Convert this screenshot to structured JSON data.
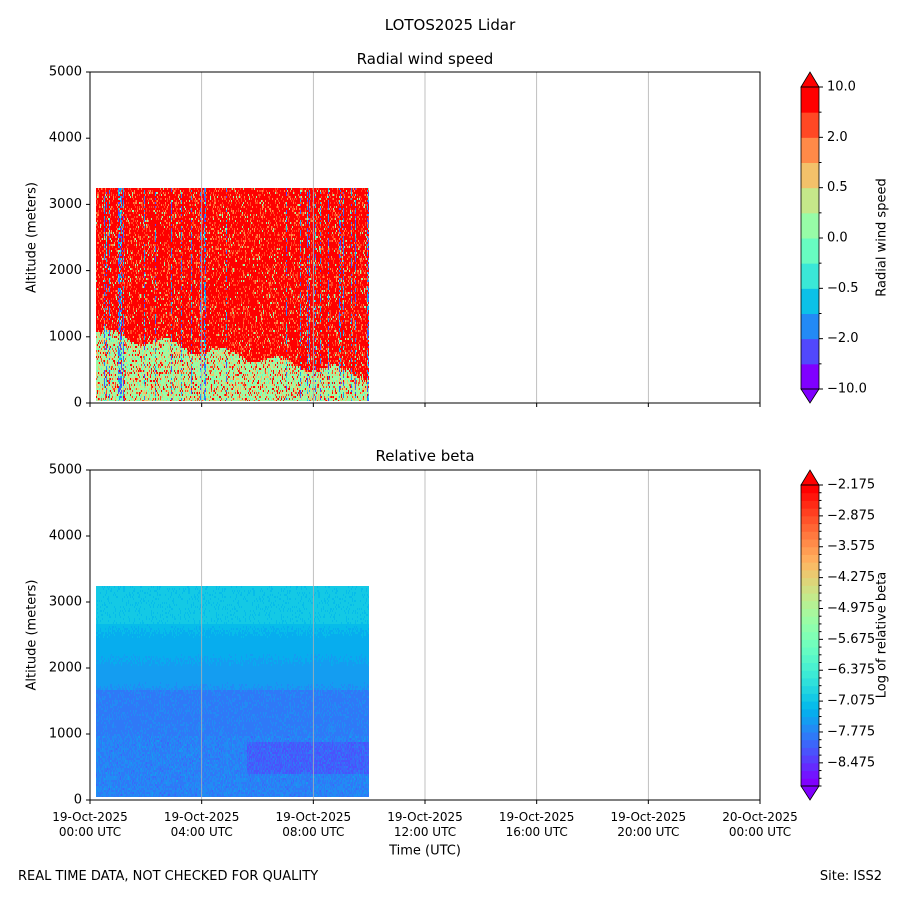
{
  "suptitle": "LOTOS2025 Lidar",
  "footer_left": "REAL TIME DATA, NOT CHECKED FOR QUALITY",
  "footer_right": "Site: ISS2",
  "chart_data": [
    {
      "type": "heatmap",
      "title": "Radial wind speed",
      "ylabel": "Altitude (meters)",
      "xlabel": "",
      "xlim": [
        "2025-10-19 00:00",
        "2025-10-20 00:00"
      ],
      "ylim": [
        0,
        5000
      ],
      "yticks": [
        "0",
        "1000",
        "2000",
        "3000",
        "4000",
        "5000"
      ],
      "xgrid": true,
      "ygrid": false,
      "data_extent": {
        "time": [
          "2025-10-19 00:13",
          "2025-10-19 10:00"
        ],
        "altitude": [
          25,
          3250
        ]
      },
      "colormap": "rainbow",
      "colorbar": {
        "label": "Radial wind speed",
        "levels": [
          -10,
          -5,
          -2,
          -1,
          -0.5,
          -0.2,
          0,
          0.2,
          0.5,
          1,
          2,
          5,
          10
        ],
        "ticklabels": [
          "10.0",
          "2.0",
          "0.5",
          "0.0",
          "−0.5",
          "−2.0",
          "−10.0"
        ],
        "extend": "both"
      },
      "description_values": {
        "above_boundary_layer": "mostly > 5",
        "below_boundary_layer": "mostly 0 to 1",
        "boundary_layer_height_m": [
          300,
          1100
        ]
      }
    },
    {
      "type": "heatmap",
      "title": "Relative beta",
      "ylabel": "Altitude (meters)",
      "xlabel": "Time (UTC)",
      "xlim": [
        "2025-10-19 00:00",
        "2025-10-20 00:00"
      ],
      "ylim": [
        0,
        5000
      ],
      "yticks": [
        "0",
        "1000",
        "2000",
        "3000",
        "4000",
        "5000"
      ],
      "xticks": [
        [
          "19-Oct-2025",
          "00:00 UTC"
        ],
        [
          "19-Oct-2025",
          "04:00 UTC"
        ],
        [
          "19-Oct-2025",
          "08:00 UTC"
        ],
        [
          "19-Oct-2025",
          "12:00 UTC"
        ],
        [
          "19-Oct-2025",
          "16:00 UTC"
        ],
        [
          "19-Oct-2025",
          "20:00 UTC"
        ],
        [
          "20-Oct-2025",
          "00:00 UTC"
        ]
      ],
      "xgrid": true,
      "ygrid": false,
      "data_extent": {
        "time": [
          "2025-10-19 00:13",
          "2025-10-19 10:00"
        ],
        "altitude": [
          50,
          3250
        ]
      },
      "colormap": "rainbow",
      "colorbar": {
        "label": "Log of relative beta",
        "range": [
          -9.0,
          -2.175
        ],
        "step": 0.175,
        "ticklabels": [
          "−2.175",
          "−2.875",
          "−3.575",
          "−4.275",
          "−4.975",
          "−5.675",
          "−6.375",
          "−7.075",
          "−7.775",
          "−8.475"
        ],
        "extend": "both"
      },
      "description_values": {
        "upper": "about -7.1",
        "lower": "about -7.8 to -8.3"
      }
    }
  ]
}
